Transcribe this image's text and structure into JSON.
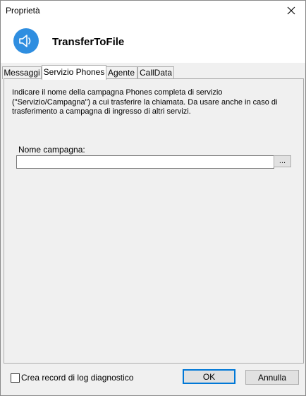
{
  "window": {
    "title": "Proprietà"
  },
  "header": {
    "title": "TransferToFile"
  },
  "tabs": [
    {
      "label": "Messaggi"
    },
    {
      "label": "Servizio Phones"
    },
    {
      "label": "Agente"
    },
    {
      "label": "CallData"
    }
  ],
  "active_tab": "Servizio Phones",
  "panel": {
    "description": "Indicare il nome della campagna Phones completa di servizio (\"Servizio/Campagna\") a cui trasferire la chiamata. Da usare anche in caso di trasferimento a campagna di ingresso di altri servizi.",
    "field_label": "Nome campagna:",
    "field_value": "",
    "browse_label": "..."
  },
  "footer": {
    "checkbox_label": "Crea record di log diagnostico",
    "checkbox_checked": false,
    "ok_label": "OK",
    "cancel_label": "Annulla"
  },
  "icons": {
    "header_icon": "speaker-icon",
    "close": "close-icon"
  },
  "colors": {
    "accent": "#0078d7",
    "icon_bg": "#2f8ee0"
  }
}
